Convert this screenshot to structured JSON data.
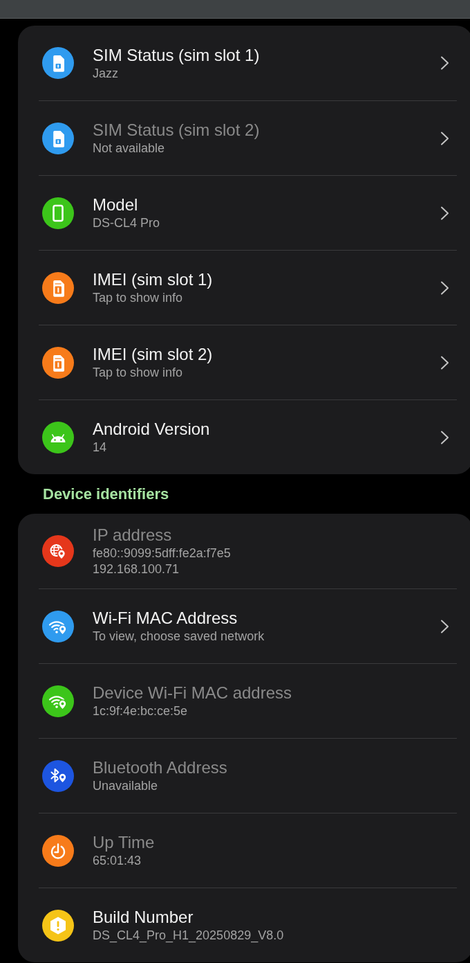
{
  "sections": [
    {
      "items": [
        {
          "title": "SIM Status (sim slot 1)",
          "lines": [
            "Jazz"
          ],
          "enabled": true,
          "chevron": true,
          "color": "#2f9bef"
        },
        {
          "title": "SIM Status (sim slot 2)",
          "lines": [
            "Not available"
          ],
          "enabled": false,
          "chevron": true,
          "color": "#2f9bef"
        },
        {
          "title": "Model",
          "lines": [
            "DS-CL4 Pro"
          ],
          "enabled": true,
          "chevron": true,
          "color": "#3cc51a"
        },
        {
          "title": "IMEI (sim slot 1)",
          "lines": [
            "Tap to show info"
          ],
          "enabled": true,
          "chevron": true,
          "color": "#f77b1a"
        },
        {
          "title": "IMEI (sim slot 2)",
          "lines": [
            "Tap to show info"
          ],
          "enabled": true,
          "chevron": true,
          "color": "#f77b1a"
        },
        {
          "title": "Android Version",
          "lines": [
            "14"
          ],
          "enabled": true,
          "chevron": true,
          "color": "#3cc51a"
        }
      ]
    },
    {
      "title": "Device identifiers",
      "items": [
        {
          "title": "IP address",
          "lines": [
            "fe80::9099:5dff:fe2a:f7e5",
            "192.168.100.71"
          ],
          "enabled": false,
          "chevron": false,
          "color": "#e5371b"
        },
        {
          "title": "Wi-Fi MAC Address",
          "lines": [
            "To view, choose saved network"
          ],
          "enabled": true,
          "chevron": true,
          "color": "#2f9bef"
        },
        {
          "title": "Device Wi-Fi MAC address",
          "lines": [
            "1c:9f:4e:bc:ce:5e"
          ],
          "enabled": false,
          "chevron": false,
          "color": "#3cc51a"
        },
        {
          "title": "Bluetooth Address",
          "lines": [
            "Unavailable"
          ],
          "enabled": false,
          "chevron": false,
          "color": "#1d55e0"
        },
        {
          "title": "Up Time",
          "lines": [
            "65:01:43"
          ],
          "enabled": false,
          "chevron": false,
          "color": "#f77b1a"
        },
        {
          "title": "Build Number",
          "lines": [
            "DS_CL4_Pro_H1_20250829_V8.0"
          ],
          "enabled": true,
          "chevron": false,
          "color": "#f5c417"
        }
      ]
    }
  ]
}
